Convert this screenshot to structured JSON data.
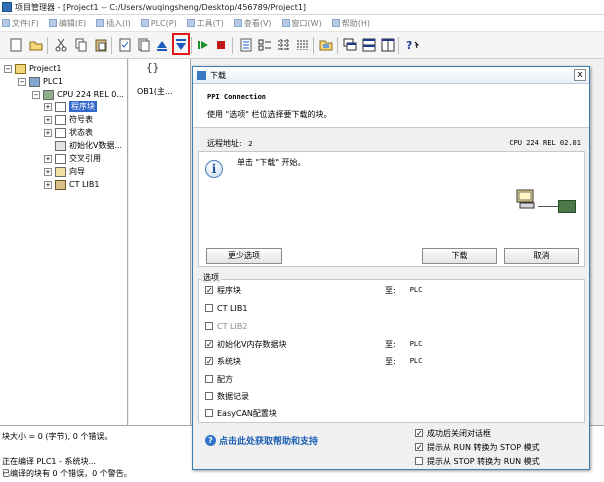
{
  "window": {
    "title": "项目管理器 - [Project1 -- C:/Users/wuqingsheng/Desktop/456789/Project1]"
  },
  "menu": [
    {
      "label": "文件(F)"
    },
    {
      "label": "编辑(E)"
    },
    {
      "label": "插入(I)"
    },
    {
      "label": "PLC(P)"
    },
    {
      "label": "工具(T)"
    },
    {
      "label": "查看(V)"
    },
    {
      "label": "窗口(W)"
    },
    {
      "label": "帮助(H)"
    }
  ],
  "toolbar": {
    "icons": [
      "new-icon",
      "open-icon",
      "cut-icon",
      "copy-icon",
      "paste-icon",
      "compile-icon",
      "compile-all-icon",
      "upload-icon",
      "download-icon",
      "run-icon",
      "stop-icon",
      "ladder-icon",
      "stl-icon",
      "fbd-icon",
      "table-icon",
      "folder-icon",
      "cascade-icon",
      "tile-horizontal-icon",
      "tile-vertical-icon",
      "help-icon"
    ]
  },
  "tree": {
    "project": "Project1",
    "plc": "PLC1",
    "cpu": "CPU 224 REL 0...",
    "items": [
      "程序块",
      "符号表",
      "状态表",
      "初始化V数据...",
      "交叉引用",
      "向导",
      "CT LIB1"
    ]
  },
  "blocks": {
    "ob1": "OB1(主..."
  },
  "output": {
    "line1": "块大小 = 0 (字节), 0 个错误。",
    "line2": "正在编译 PLC1 - 系统块...",
    "line3": "已编译的块有 0 个错误，0 个警告。"
  },
  "dialog": {
    "title": "下载",
    "close": "x",
    "header_title": "PPI Connection",
    "header_sub": "使用 \"选项\" 栏位选择要下载的块。",
    "addr_label": "远程地址:",
    "addr_value": "2",
    "cpu_id": "CPU 224 REL 02.01",
    "info_text": "单击 \"下载\" 开始。",
    "btn_fewer": "更少选项",
    "btn_download": "下载",
    "btn_cancel": "取消",
    "options_title": "选项",
    "options": [
      {
        "label": "程序块",
        "checked": true,
        "target": "至:",
        "target_value": "PLC"
      },
      {
        "label": "CT LIB1",
        "checked": false,
        "target": "",
        "target_value": ""
      },
      {
        "label": "CT LIB2",
        "checked": false,
        "disabled": true,
        "target": "",
        "target_value": ""
      },
      {
        "label": "初始化V内存数据块",
        "checked": true,
        "target": "至:",
        "target_value": "PLC"
      },
      {
        "label": "系统块",
        "checked": true,
        "target": "至:",
        "target_value": "PLC"
      },
      {
        "label": "配方",
        "checked": false,
        "target": "",
        "target_value": ""
      },
      {
        "label": "数据记录",
        "checked": false,
        "target": "",
        "target_value": ""
      },
      {
        "label": "EasyCAN配置块",
        "checked": false,
        "target": "",
        "target_value": ""
      }
    ],
    "help_link": "点击此处获取帮助和支持",
    "after": [
      {
        "label": "成功后关闭对话框",
        "checked": true
      },
      {
        "label": "提示从 RUN 转换为 STOP 模式",
        "checked": true
      },
      {
        "label": "提示从 STOP 转换为 RUN 模式",
        "checked": false
      }
    ]
  }
}
